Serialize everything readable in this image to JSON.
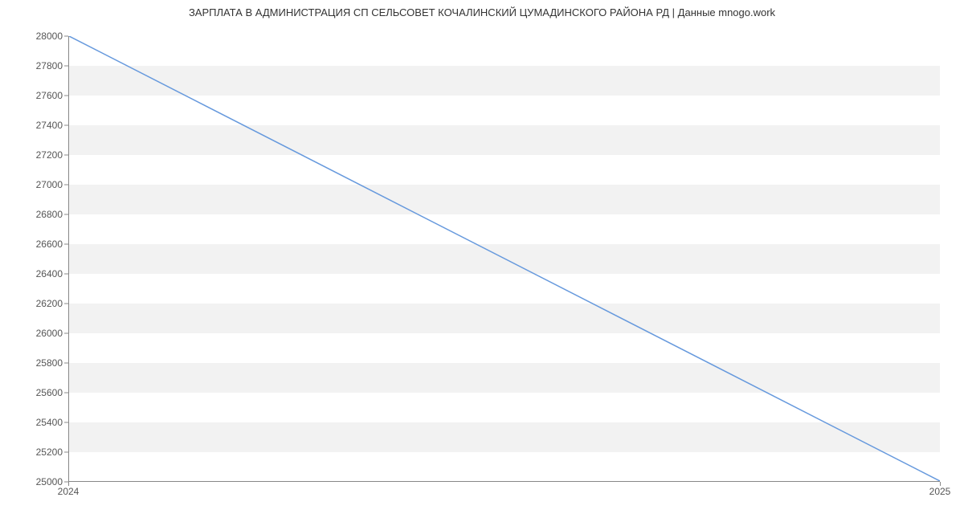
{
  "chart_data": {
    "type": "line",
    "title": "ЗАРПЛАТА В АДМИНИСТРАЦИЯ СП  СЕЛЬСОВЕТ КОЧАЛИНСКИЙ  ЦУМАДИНСКОГО РАЙОНА РД | Данные mnogo.work",
    "x": [
      2024,
      2025
    ],
    "values": [
      28000,
      25000
    ],
    "xlabel": "",
    "ylabel": "",
    "xlim": [
      2024,
      2025
    ],
    "ylim": [
      25000,
      28000
    ],
    "y_ticks": [
      25000,
      25200,
      25400,
      25600,
      25800,
      26000,
      26200,
      26400,
      26600,
      26800,
      27000,
      27200,
      27400,
      27600,
      27800,
      28000
    ],
    "x_ticks": [
      2024,
      2025
    ],
    "line_color": "#6699dd"
  }
}
